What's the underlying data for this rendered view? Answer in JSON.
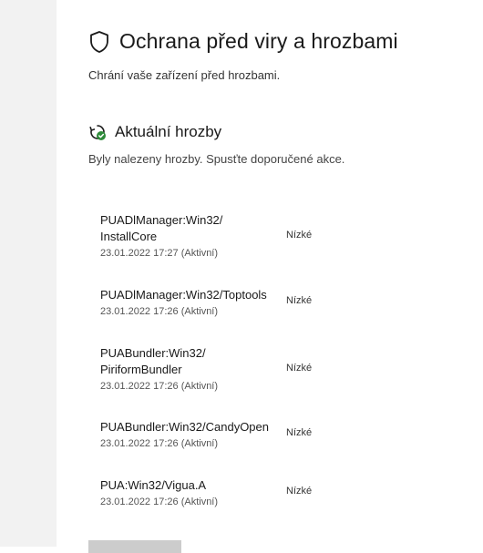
{
  "header": {
    "title": "Ochrana před viry a hrozbami",
    "subtitle": "Chrání vaše zařízení před hrozbami."
  },
  "current_threats": {
    "title": "Aktuální hrozby",
    "description": "Byly nalezeny hrozby. Spusťte doporučené akce.",
    "items": [
      {
        "name": "PUADlManager:Win32/ InstallCore",
        "time": "23.01.2022 17:27 (Aktivní)",
        "level": "Nízké"
      },
      {
        "name": "PUADlManager:Win32/Toptools",
        "time": "23.01.2022 17:26 (Aktivní)",
        "level": "Nízké"
      },
      {
        "name": "PUABundler:Win32/ PiriformBundler",
        "time": "23.01.2022 17:26 (Aktivní)",
        "level": "Nízké"
      },
      {
        "name": "PUABundler:Win32/CandyOpen",
        "time": "23.01.2022 17:26 (Aktivní)",
        "level": "Nízké"
      },
      {
        "name": "PUA:Win32/Vigua.A",
        "time": "23.01.2022 17:26 (Aktivní)",
        "level": "Nízké"
      }
    ]
  },
  "icons": {
    "header": "shield-icon",
    "section": "threat-scan-icon"
  },
  "colors": {
    "accent_green": "#2e8b3a",
    "left_pane": "#f2f2f2"
  }
}
